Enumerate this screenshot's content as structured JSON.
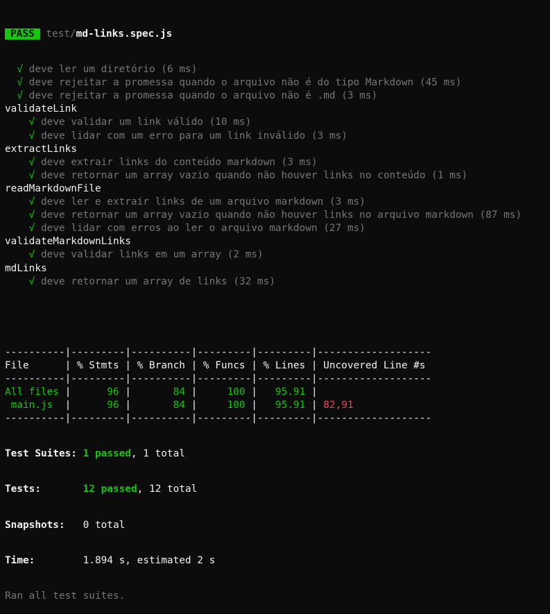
{
  "header": {
    "badge": "PASS",
    "path_dir": "test/",
    "path_file": "md-links.spec.js"
  },
  "check_glyph": "√",
  "top_tests": [
    "deve ler um diretório (6 ms)",
    "deve rejeitar a promessa quando o arquivo não é do tipo Markdown (45 ms)",
    "deve rejeitar a promessa quando o arquivo não é .md (3 ms)"
  ],
  "groups": [
    {
      "name": "validateLink",
      "tests": [
        "deve validar um link válido (10 ms)",
        "deve lidar com um erro para um link inválido (3 ms)"
      ]
    },
    {
      "name": "extractLinks",
      "tests": [
        "deve extrair links do conteúdo markdown (3 ms)",
        "deve retornar um array vazio quando não houver links no conteúdo (1 ms)"
      ]
    },
    {
      "name": "readMarkdownFile",
      "tests": [
        "deve ler e extrair links de um arquivo markdown (3 ms)",
        "deve retornar um array vazio quando não houver links no arquivo markdown (87 ms)",
        "deve lidar com erros ao ler o arquivo markdown (27 ms)"
      ]
    },
    {
      "name": "validateMarkdownLinks",
      "tests": [
        "deve validar links em um array (2 ms)"
      ]
    },
    {
      "name": "mdLinks",
      "tests": [
        "deve retornar um array de links (32 ms)"
      ]
    }
  ],
  "coverage": {
    "separator": "----------|---------|----------|---------|---------|-------------------",
    "header": "File      | % Stmts | % Branch | % Funcs | % Lines | Uncovered Line #s ",
    "rows": [
      {
        "file": "All files ",
        "stmts": "      96 ",
        "branch": "       84 ",
        "funcs": "     100 ",
        "lines": "   95.91 ",
        "uncovered": "                   "
      },
      {
        "file": " main.js  ",
        "stmts": "      96 ",
        "branch": "       84 ",
        "funcs": "     100 ",
        "lines": "   95.91 ",
        "uncovered": " 82,91             "
      }
    ]
  },
  "summary": {
    "suites_label": "Test Suites: ",
    "suites_passed": "1 passed",
    "suites_total": ", 1 total",
    "tests_label": "Tests:       ",
    "tests_passed": "12 passed",
    "tests_total": ", 12 total",
    "snapshots_label": "Snapshots:   ",
    "snapshots_value": "0 total",
    "time_label": "Time:        ",
    "time_value": "1.894 s, estimated 2 s",
    "footer": "Ran all test suites."
  }
}
